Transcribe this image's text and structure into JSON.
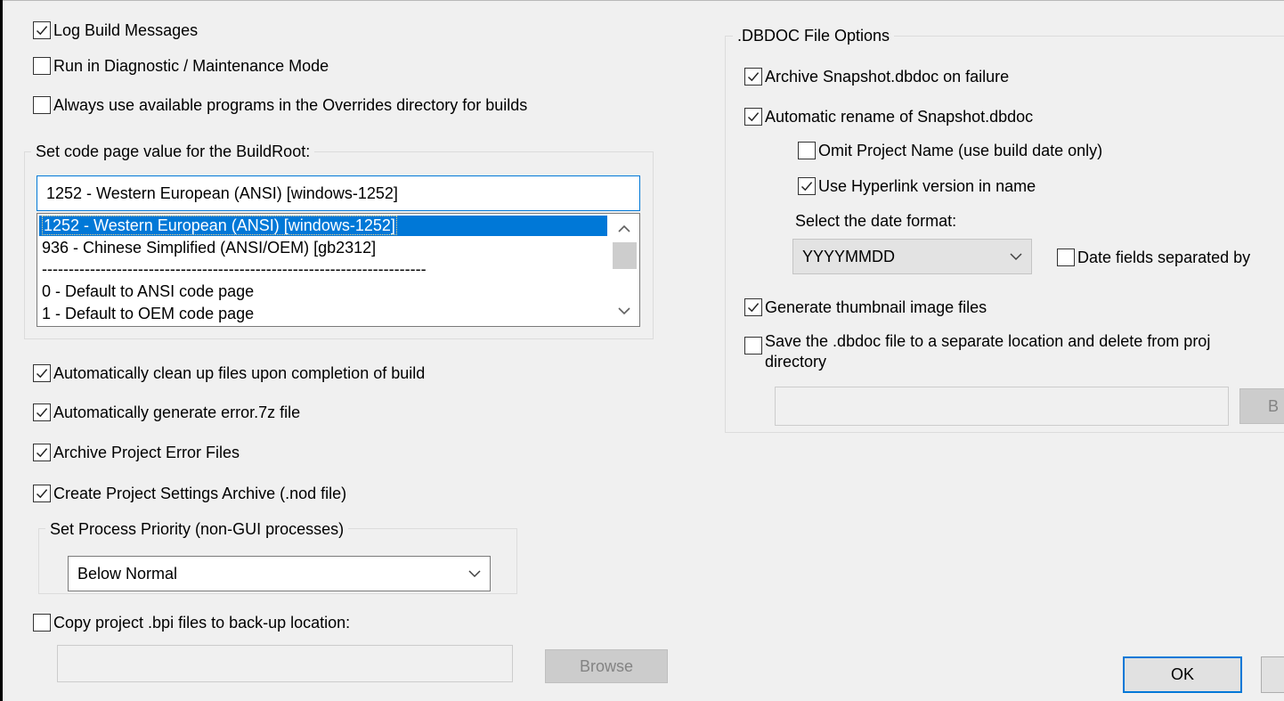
{
  "left": {
    "log_build": {
      "label": "Log Build Messages",
      "checked": true
    },
    "diagnostic": {
      "label": "Run in Diagnostic / Maintenance Mode",
      "checked": false
    },
    "overrides": {
      "label": "Always use available programs in the Overrides directory for builds",
      "checked": false
    },
    "codepage_group": {
      "title": "Set code page value for the BuildRoot:",
      "current_value": "1252 - Western European (ANSI) [windows-1252]",
      "options": [
        "1252 - Western European (ANSI) [windows-1252]",
        "936 - Chinese Simplified (ANSI/OEM) [gb2312]",
        "------------------------------------------------------------------------",
        "0 - Default to ANSI code page",
        "1 - Default to OEM code page"
      ],
      "selected_index": 0
    },
    "cleanup": {
      "label": "Automatically clean up files upon completion of build",
      "checked": true
    },
    "gen_error": {
      "label": "Automatically generate error.7z file",
      "checked": true
    },
    "archive_errors": {
      "label": "Archive Project Error Files",
      "checked": true
    },
    "settings_archive": {
      "label": "Create Project Settings Archive (.nod file)",
      "checked": true
    },
    "priority_group": {
      "title": "Set Process Priority (non-GUI processes)",
      "selected": "Below Normal"
    },
    "copy_bpi": {
      "label": "Copy project .bpi files to back-up location:",
      "checked": false
    },
    "backup_path": "",
    "browse_label": "Browse"
  },
  "right": {
    "group_title": ".DBDOC File Options",
    "archive_snapshot": {
      "label": "Archive Snapshot.dbdoc on failure",
      "checked": true
    },
    "auto_rename": {
      "label": "Automatic rename of Snapshot.dbdoc",
      "checked": true
    },
    "omit_project": {
      "label": "Omit Project Name (use build date only)",
      "checked": false
    },
    "use_hyperlink": {
      "label": "Use Hyperlink version in name",
      "checked": true
    },
    "date_format_label": "Select the date format:",
    "date_format_value": "YYYYMMDD",
    "date_sep": {
      "label": "Date fields separated by",
      "checked": false
    },
    "thumbnails": {
      "label": "Generate thumbnail image files",
      "checked": true
    },
    "save_separate": {
      "label": "Save the .dbdoc file to a separate location and delete from proj",
      "label2": "directory",
      "checked": false
    },
    "save_path": "",
    "browse_partial": "B"
  },
  "footer": {
    "ok_label": "OK"
  },
  "icons": {
    "check": "checkmark-icon",
    "dropdown": "chevron-down-icon",
    "scroll_up": "chevron-up-icon",
    "scroll_down": "chevron-down-icon"
  },
  "colors": {
    "accent": "#0078d7",
    "background": "#f0f0f0"
  }
}
